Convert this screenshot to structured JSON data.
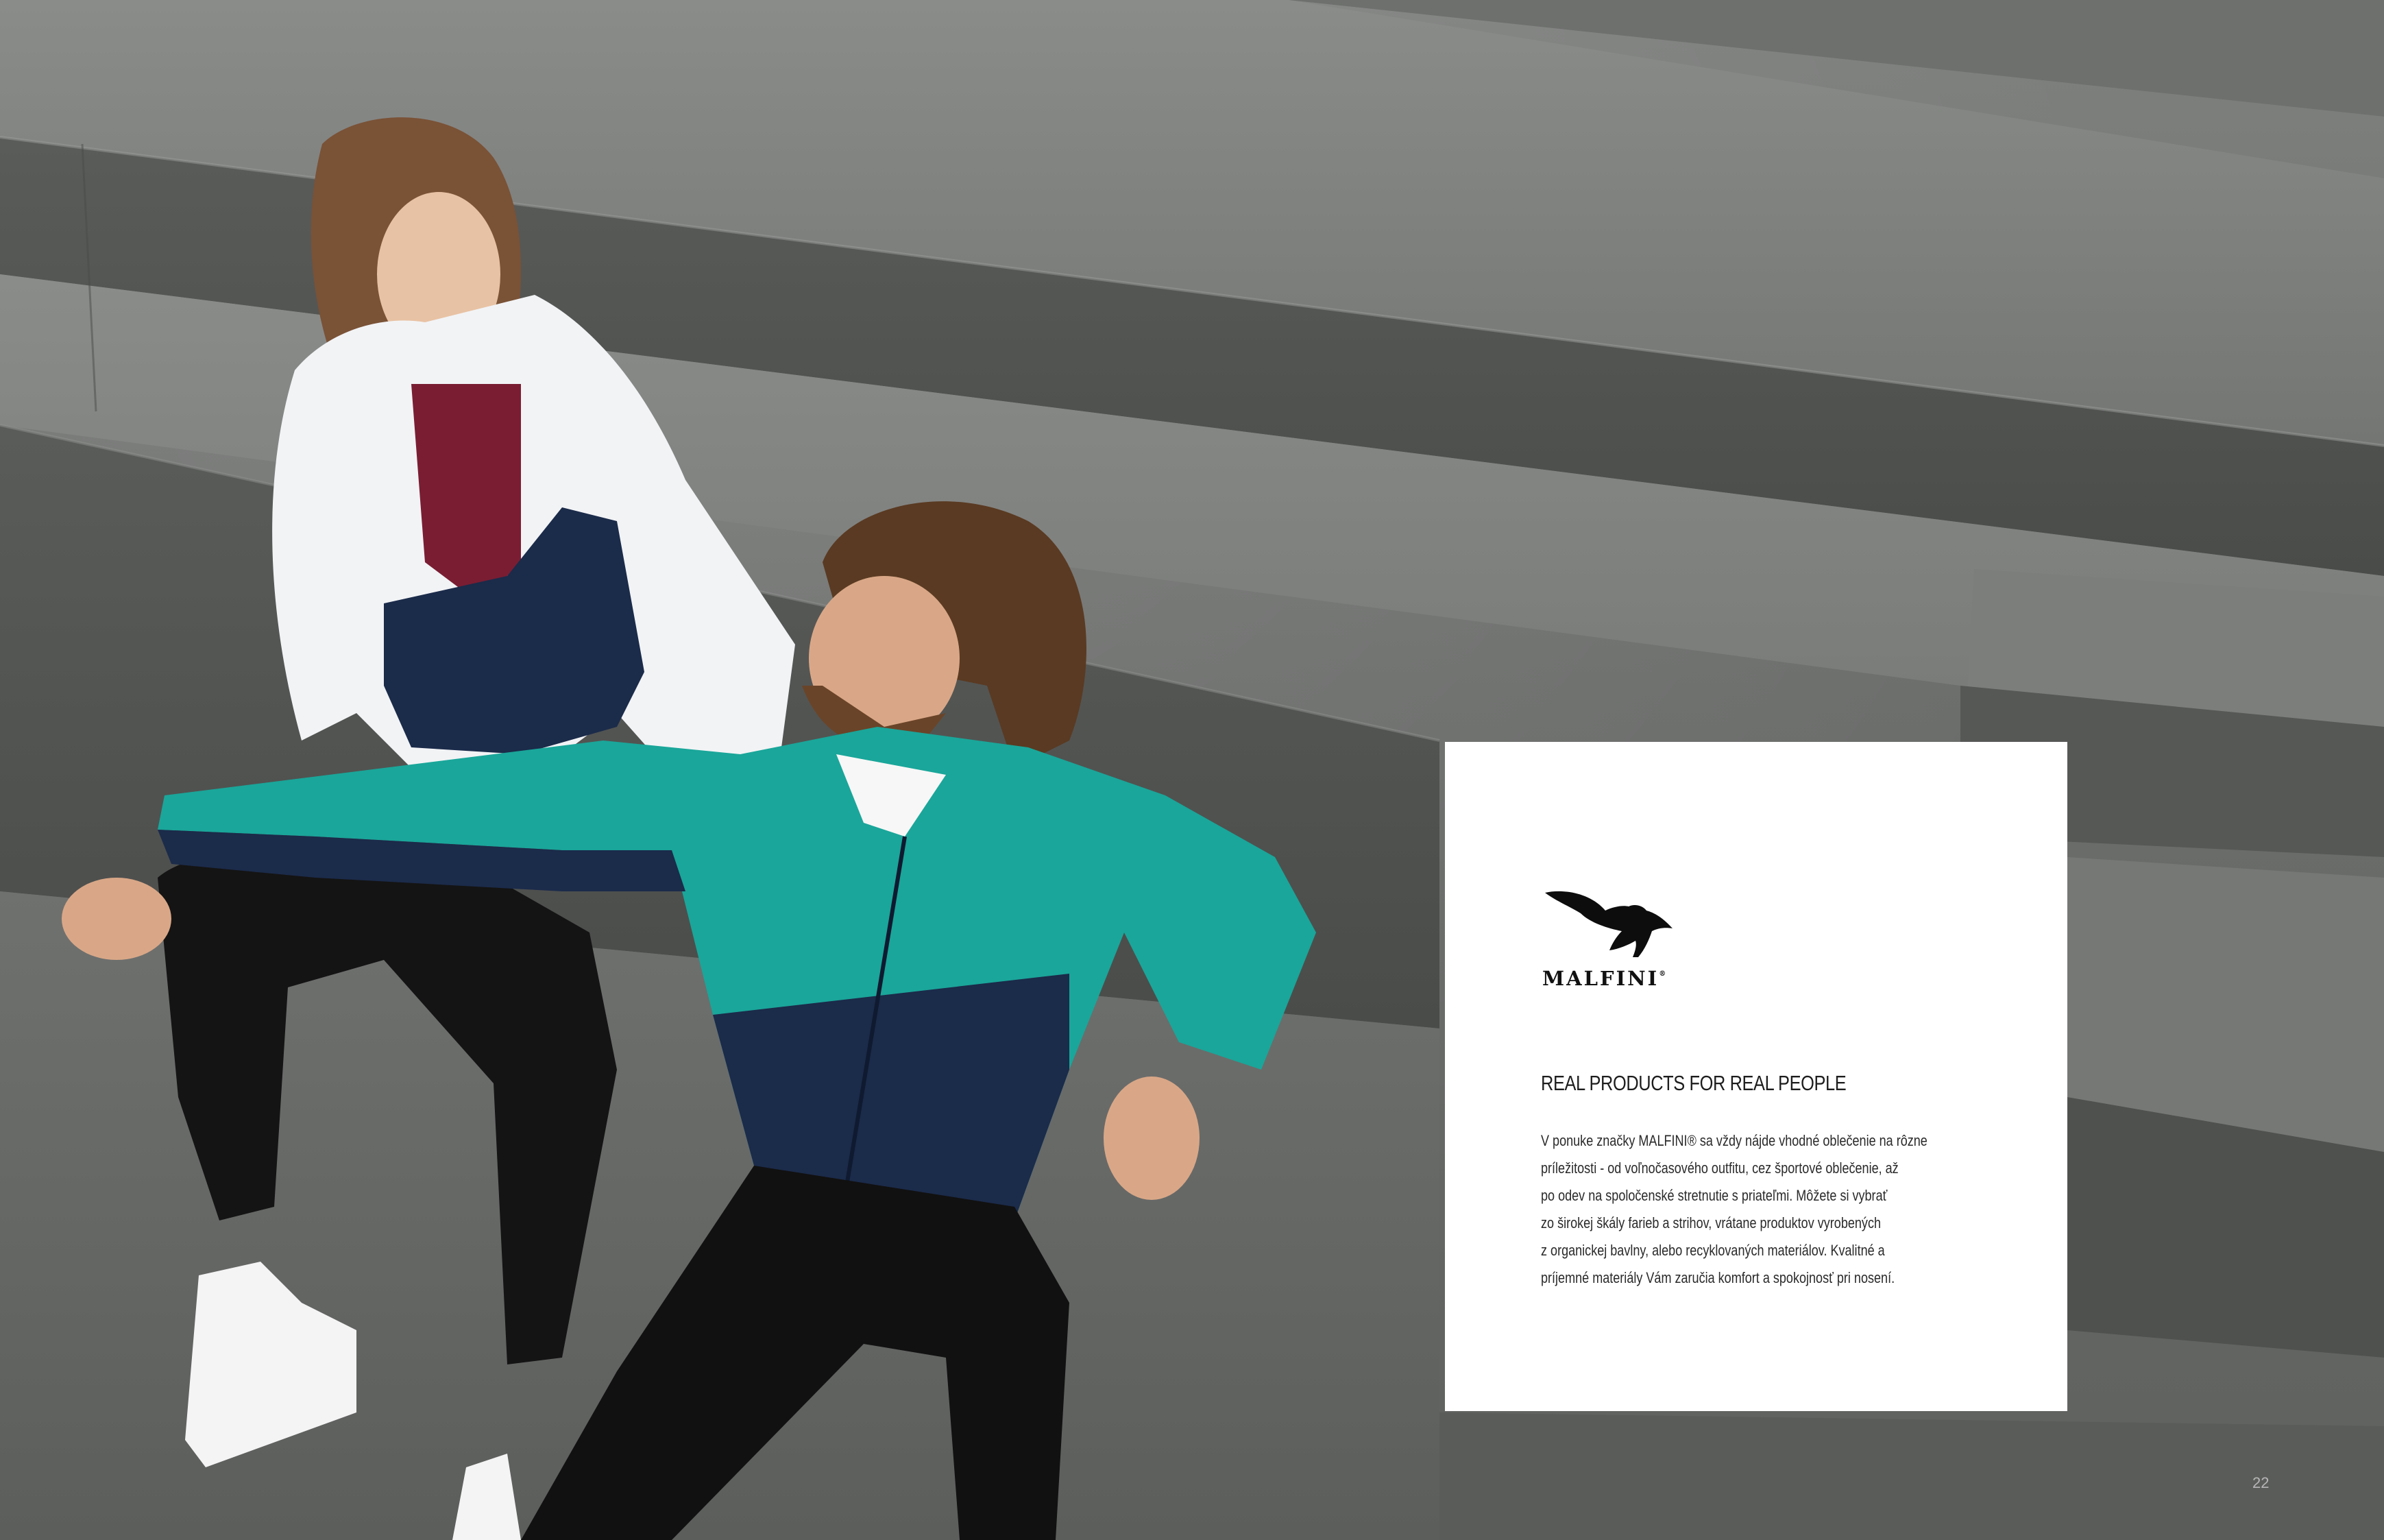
{
  "brand": {
    "name": "MALFINI",
    "registered_mark": "®"
  },
  "headline": "REAL PRODUCTS FOR REAL PEOPLE",
  "body_lines": [
    "V ponuke značky MALFINI® sa vždy nájde vhodné oblečenie na rôzne",
    "príležitosti - od voľnočasového outfitu, cez športové oblečenie, až",
    "po odev na spoločenské stretnutie s priateľmi. Môžete si vybrať",
    "zo širokej škály farieb a strihov, vrátane produktov vyrobených",
    "z organickej bavlny, alebo recyklovaných materiálov. Kvalitné a",
    "príjemné materiály Vám zaručia komfort a spokojnosť pri nosení."
  ],
  "page_number": "22",
  "colors": {
    "card_background": "#ffffff",
    "text": "#1d1d1d",
    "concrete": "#6d6f6d",
    "jacket_teal": "#1aa69a",
    "jacket_navy": "#1b2b4a",
    "jacket_white": "#f2f3f5",
    "shirt_burgundy": "#7a1d33"
  },
  "icons": {
    "brand_logo": "eagle-logo-icon"
  }
}
